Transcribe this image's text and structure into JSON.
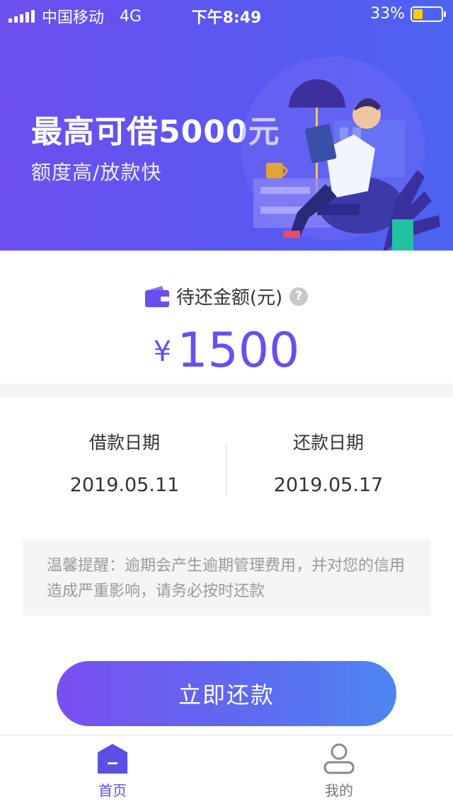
{
  "status_bar": {
    "carrier": "中国移动",
    "network": "4G",
    "time": "下午8:49",
    "battery_percent": "33%",
    "battery_level": 0.33
  },
  "hero": {
    "title": "最高可借5000元",
    "subtitle": "额度高/放款快"
  },
  "repayment": {
    "label": "待还金额(元)",
    "currency_symbol": "¥",
    "amount": "1500"
  },
  "dates": {
    "borrow_label": "借款日期",
    "borrow_date": "2019.05.11",
    "repay_label": "还款日期",
    "repay_date": "2019.05.17"
  },
  "notice": {
    "text": "温馨提醒：逾期会产生逾期管理费用，并对您的信用造成严重影响，请务必按时还款"
  },
  "actions": {
    "repay_now": "立即还款"
  },
  "tabbar": {
    "home": "首页",
    "mine": "我的"
  },
  "colors": {
    "accent": "#6a4ef0",
    "hero_start": "#6d4ff0",
    "hero_end": "#4d63f2",
    "battery_fill": "#ffcc00"
  }
}
